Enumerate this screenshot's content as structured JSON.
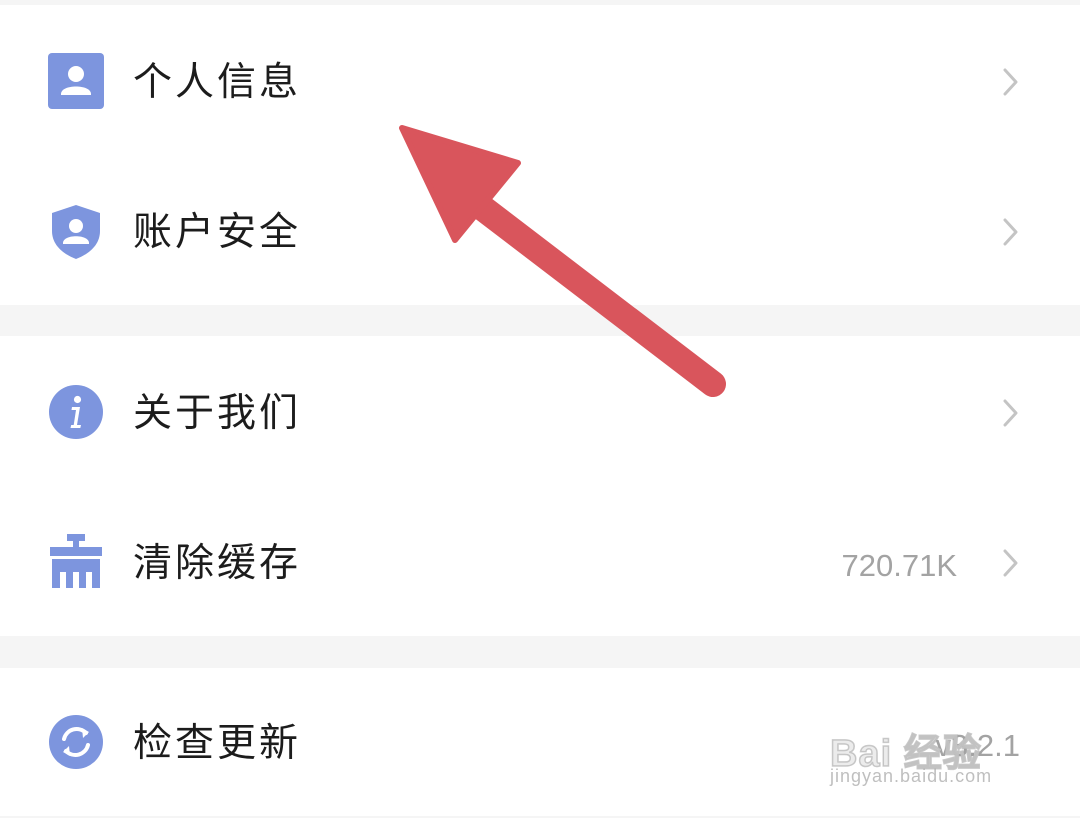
{
  "settings": {
    "groups": [
      {
        "items": [
          {
            "label": "个人信息",
            "icon": "user-card-icon"
          },
          {
            "label": "账户安全",
            "icon": "shield-user-icon"
          }
        ]
      },
      {
        "items": [
          {
            "label": "关于我们",
            "icon": "info-icon"
          },
          {
            "label": "清除缓存",
            "icon": "broom-icon",
            "value": "720.71K"
          }
        ]
      },
      {
        "items": [
          {
            "label": "检查更新",
            "icon": "refresh-icon",
            "value": "v3.2.1"
          }
        ]
      }
    ]
  },
  "colors": {
    "icon_accent": "#7d95de",
    "arrow": "#d9555c",
    "chevron": "#c4c4c4"
  },
  "watermark": {
    "logo_text": "Bai 经验",
    "sub_text": "jingyan.baidu.com"
  }
}
